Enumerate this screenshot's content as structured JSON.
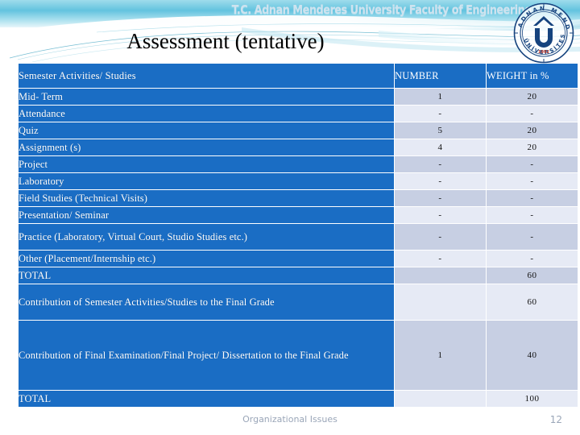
{
  "header": {
    "banner_title": "T.C.    Adnan Menderes University    Faculty of Engineering",
    "logo_name": "adnan-menderes-university-seal",
    "logo_outer_text": "ADNAN MENDERES",
    "logo_bottom_text": "ÜNİVERSİTESİ",
    "logo_year": "1992"
  },
  "slide": {
    "title": "Assessment (tentative)"
  },
  "table": {
    "headers": {
      "label": "Semester Activities/ Studies",
      "number": "NUMBER",
      "weight": "WEIGHT in %"
    },
    "rows": [
      {
        "label": "Mid- Term",
        "number": "1",
        "weight": "20",
        "size": "short",
        "tint": "a"
      },
      {
        "label": "Attendance",
        "number": "-",
        "weight": "-",
        "size": "short",
        "tint": "b"
      },
      {
        "label": "Quiz",
        "number": "5",
        "weight": "20",
        "size": "short",
        "tint": "a"
      },
      {
        "label": "Assignment (s)",
        "number": "4",
        "weight": "20",
        "size": "short",
        "tint": "b"
      },
      {
        "label": "Project",
        "number": "-",
        "weight": "-",
        "size": "short",
        "tint": "a"
      },
      {
        "label": "Laboratory",
        "number": "-",
        "weight": "-",
        "size": "short",
        "tint": "b"
      },
      {
        "label": "Field Studies (Technical Visits)",
        "number": "-",
        "weight": "-",
        "size": "short",
        "tint": "a"
      },
      {
        "label": "Presentation/ Seminar",
        "number": "-",
        "weight": "-",
        "size": "short",
        "tint": "b"
      },
      {
        "label": "Practice (Laboratory, Virtual Court, Studio Studies etc.)",
        "number": "-",
        "weight": "-",
        "size": "tall",
        "tint": "a"
      },
      {
        "label": "Other (Placement/Internship etc.)",
        "number": "-",
        "weight": "-",
        "size": "short",
        "tint": "b"
      },
      {
        "label": "TOTAL",
        "number": "",
        "weight": "60",
        "size": "short",
        "tint": "a"
      },
      {
        "label": "Contribution of Semester Activities/Studies to the Final Grade",
        "number": "",
        "weight": "60",
        "size": "xtall",
        "tint": "b"
      },
      {
        "label": "Contribution of Final Examination/Final Project/ Dissertation to the Final Grade",
        "number": "1",
        "weight": "40",
        "size": "huge",
        "tint": "a"
      },
      {
        "label": "TOTAL",
        "number": "",
        "weight": "100",
        "size": "short",
        "tint": "b"
      }
    ]
  },
  "footer": {
    "text": "Organizational Issues",
    "page": "12"
  },
  "colors": {
    "table_blue": "#1a6dc4",
    "cell_tint_dark": "#c7cfe3",
    "cell_tint_light": "#e6eaf5",
    "banner_cyan": "#6fc7e0",
    "footer_grey": "#9aa6b8"
  }
}
